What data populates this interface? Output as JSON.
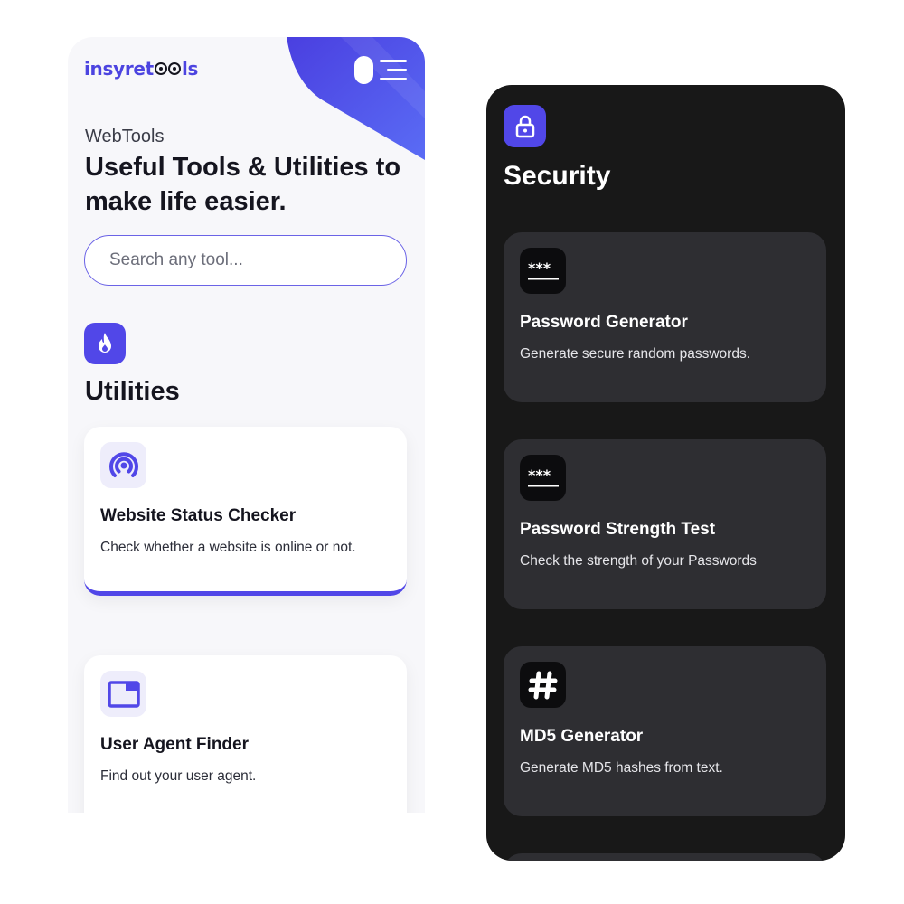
{
  "colors": {
    "accent": "#5147e8",
    "accent_light": "#eeedfb",
    "light_bg": "#f7f7fa",
    "dark_bg": "#181818",
    "dark_card": "#2e2e32",
    "text_dark": "#15151f"
  },
  "light": {
    "header": {
      "logo_part1": "insyret",
      "logo_part2": "ls",
      "logo_icon": "goggle-eyes-icon",
      "toggle_icon": "theme-toggle-icon",
      "menu_icon": "hamburger-menu-icon"
    },
    "hero": {
      "kicker": "WebTools",
      "headline": "Useful Tools & Utilities to make life easier."
    },
    "search": {
      "placeholder": "Search any tool..."
    },
    "category": {
      "title": "Utilities",
      "icon": "flame-icon"
    },
    "tools": [
      {
        "name": "Website Status Checker",
        "description": "Check whether a website is online or not.",
        "icon": "broadcast-signal-icon"
      },
      {
        "name": "User Agent Finder",
        "description": "Find out your user agent.",
        "icon": "browser-window-icon"
      }
    ]
  },
  "dark": {
    "category": {
      "title": "Security",
      "icon": "lock-icon"
    },
    "tools": [
      {
        "name": "Password Generator",
        "description": "Generate secure random passwords.",
        "icon": "password-asterisk-icon"
      },
      {
        "name": "Password Strength Test",
        "description": "Check the strength of your Passwords",
        "icon": "password-asterisk-icon"
      },
      {
        "name": "MD5 Generator",
        "description": "Generate MD5 hashes from text.",
        "icon": "hashtag-icon"
      }
    ]
  }
}
